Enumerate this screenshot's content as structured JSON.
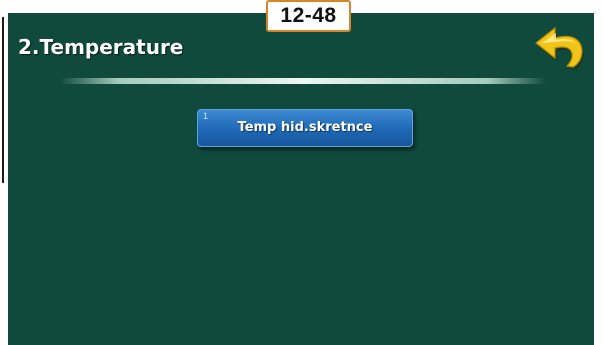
{
  "page_code": "12-48",
  "screen": {
    "title": "2.Temperature",
    "background": "#0f4a3d"
  },
  "back_button": {
    "icon": "back-arrow-icon",
    "color": "#f2c418"
  },
  "menu": {
    "items": [
      {
        "index": "1",
        "label": "Temp hid.skretnce",
        "color": "#1e68b6"
      }
    ]
  }
}
